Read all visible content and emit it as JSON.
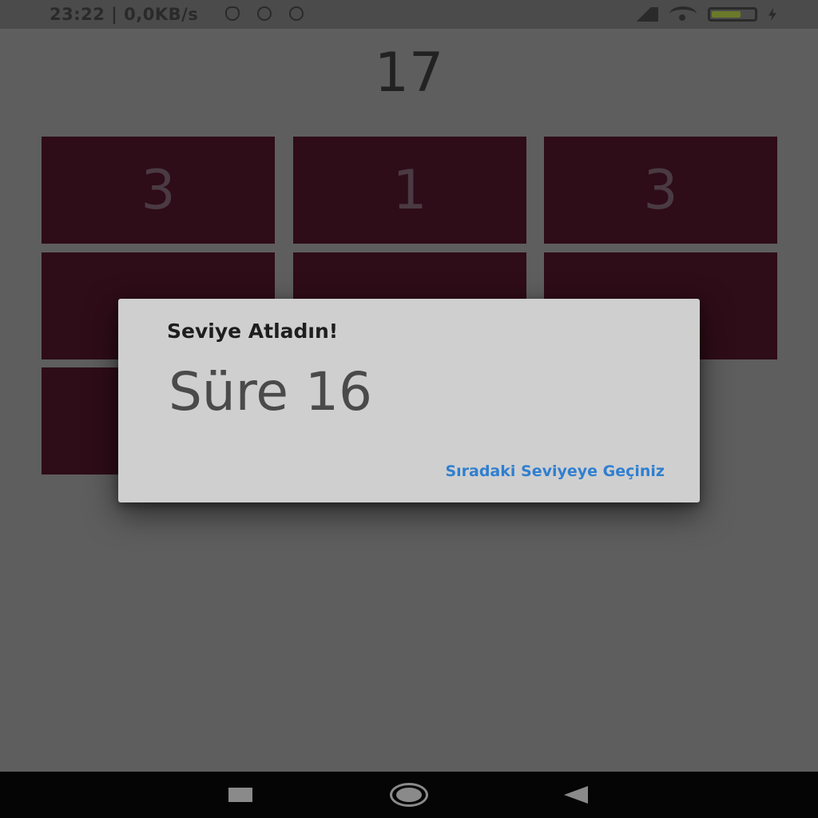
{
  "status_bar": {
    "time": "23:22 | 0,0KB/s",
    "icons": [
      "alarm-icon",
      "notification-icon",
      "notification-icon",
      "signal-icon",
      "wifi-icon",
      "battery-icon",
      "charging-icon"
    ],
    "battery_level": 0.7
  },
  "game": {
    "score": "17",
    "tiles": [
      "3",
      "1",
      "3",
      "",
      "",
      "",
      "",
      "",
      ""
    ]
  },
  "dialog": {
    "title": "Seviye Atladın!",
    "message": "Süre 16",
    "action_label": "Sıradaki Seviyeye Geçiniz"
  },
  "nav_bar": {
    "buttons": [
      "recent-apps-icon",
      "home-icon",
      "back-icon"
    ]
  }
}
